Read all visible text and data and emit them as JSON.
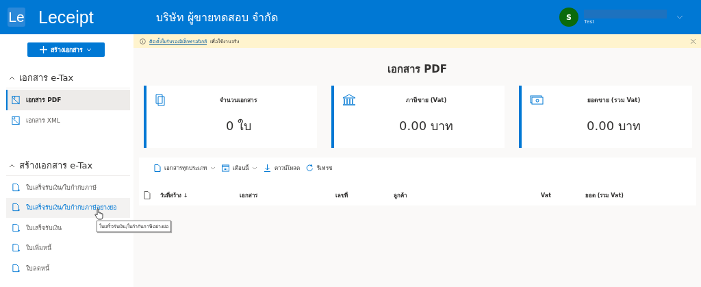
{
  "header": {
    "logo_mark": "Le",
    "app_name": "Leceipt",
    "company": "บริษัท ผู้ขายทดสอบ จำกัด",
    "user": {
      "avatar": "S",
      "subtitle": "Test"
    }
  },
  "notice": {
    "link": "ติดตั้งใบรับรองอิเล็กทรอนิกส์",
    "text": "เพื่อใช้งานจริง"
  },
  "sidebar": {
    "create_button": "สร้างเอกสาร",
    "sections": [
      {
        "title": "เอกสาร e-Tax",
        "expanded": true,
        "kind": "view",
        "items": [
          {
            "label": "เอกสาร PDF",
            "selected": true,
            "hovered": false
          },
          {
            "label": "เอกสาร XML",
            "selected": false,
            "hovered": false
          }
        ]
      },
      {
        "title": "สร้างเอกสาร e-Tax",
        "expanded": true,
        "kind": "create",
        "items": [
          {
            "label": "ใบเสร็จรับเงิน/ใบกำกับภาษี",
            "selected": false,
            "hovered": false
          },
          {
            "label": "ใบเสร็จรับเงิน/ใบกำกับภาษีอย่างย่อ",
            "selected": false,
            "hovered": true
          },
          {
            "label": "ใบเสร็จรับเงิน",
            "selected": false,
            "hovered": false
          },
          {
            "label": "ใบเพิ่มหนี้",
            "selected": false,
            "hovered": false
          },
          {
            "label": "ใบลดหนี้",
            "selected": false,
            "hovered": false
          }
        ]
      }
    ]
  },
  "tooltip": "ใบเสร็จรับเงิน/ใบกำกับภาษีอย่างย่อ",
  "page_title": "เอกสาร PDF",
  "cards": [
    {
      "kind": "documents",
      "label": "จำนวนเอกสาร",
      "value": "0 ใบ"
    },
    {
      "kind": "tax",
      "label": "ภาษีขาย (Vat)",
      "value": "0.00 บาท"
    },
    {
      "kind": "sales",
      "label": "ยอดขาย (รวม Vat)",
      "value": "0.00 บาท"
    }
  ],
  "toolbar": [
    {
      "kind": "document",
      "label": "เอกสารทุกประเภท",
      "dropdown": true
    },
    {
      "kind": "calendar",
      "label": "เดือนนี้",
      "dropdown": true
    },
    {
      "kind": "download",
      "label": "ดาวน์โหลด",
      "dropdown": false
    },
    {
      "kind": "refresh",
      "label": "รีเฟรช",
      "dropdown": false
    }
  ],
  "table": {
    "columns": [
      "วันที่สร้าง ↓",
      "เอกสาร",
      "เลขที่",
      "ลูกค้า",
      "Vat",
      "ยอด (รวม Vat)"
    ]
  }
}
